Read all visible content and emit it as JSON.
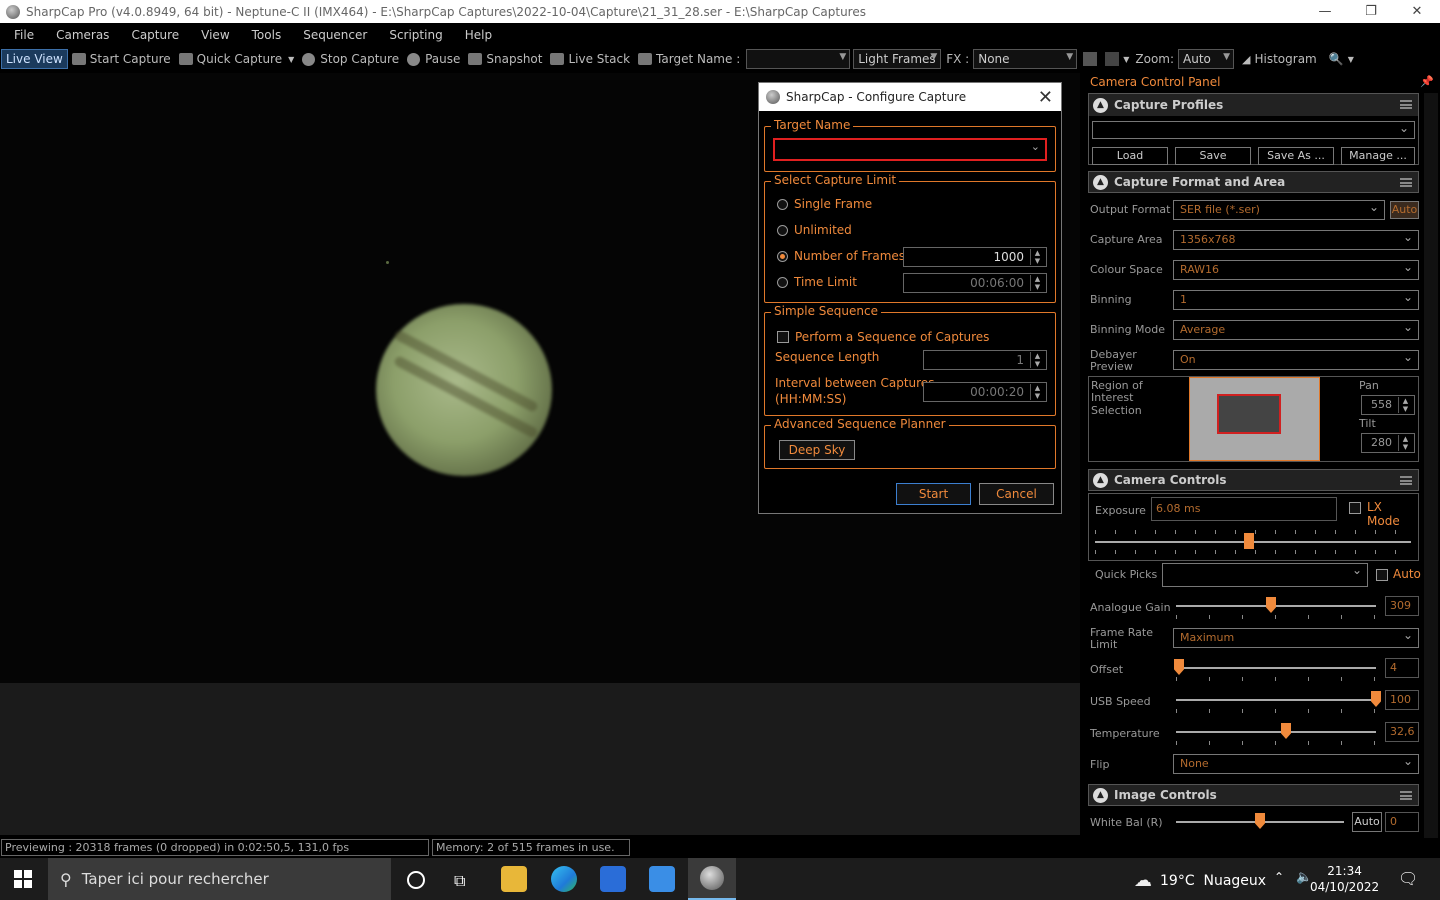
{
  "window": {
    "title": "SharpCap Pro (v4.0.8949, 64 bit) - Neptune-C II (IMX464) - E:\\SharpCap Captures\\2022-10-04\\Capture\\21_31_28.ser - E:\\SharpCap Captures",
    "minimize": "—",
    "maximize": "❐",
    "close": "✕"
  },
  "menu": [
    "File",
    "Cameras",
    "Capture",
    "View",
    "Tools",
    "Sequencer",
    "Scripting",
    "Help"
  ],
  "toolbar": {
    "live_view": "Live View",
    "start_capture": "Start Capture",
    "quick_capture": "Quick Capture",
    "stop_capture": "Stop Capture",
    "pause": "Pause",
    "snapshot": "Snapshot",
    "live_stack": "Live Stack",
    "target_name_label": "Target Name :",
    "target_name_value": "",
    "frame_type": "Light Frames",
    "fx_label": "FX :",
    "fx_value": "None",
    "zoom_label": "Zoom:",
    "zoom_value": "Auto",
    "histogram": "Histogram"
  },
  "dialog": {
    "title": "SharpCap - Configure Capture",
    "target_name_group": "Target Name",
    "target_name_value": "",
    "capture_limit_group": "Select Capture Limit",
    "single_frame": "Single Frame",
    "unlimited": "Unlimited",
    "number_of_frames": "Number of Frames",
    "number_of_frames_value": "1000",
    "time_limit": "Time Limit",
    "time_limit_value": "00:06:00",
    "simple_sequence_group": "Simple Sequence",
    "perform_sequence": "Perform a Sequence of Captures",
    "sequence_length": "Sequence Length",
    "sequence_length_value": "1",
    "interval_label": "Interval between Captures",
    "interval_format": "(HH:MM:SS)",
    "interval_value": "00:00:20",
    "advanced_group": "Advanced Sequence Planner",
    "deep_sky": "Deep Sky",
    "start": "Start",
    "cancel": "Cancel"
  },
  "panel": {
    "title": "Camera Control Panel",
    "capture_profiles": {
      "header": "Capture Profiles",
      "profile_value": "",
      "load": "Load",
      "save": "Save",
      "save_as": "Save As ...",
      "manage": "Manage ..."
    },
    "format_area": {
      "header": "Capture Format and Area",
      "output_format_label": "Output Format",
      "output_format_value": "SER file (*.ser)",
      "auto": "Auto",
      "capture_area_label": "Capture Area",
      "capture_area_value": "1356x768",
      "colour_space_label": "Colour Space",
      "colour_space_value": "RAW16",
      "binning_label": "Binning",
      "binning_value": "1",
      "binning_mode_label": "Binning Mode",
      "binning_mode_value": "Average",
      "debayer_label": "Debayer",
      "debayer_label2": "Preview",
      "debayer_value": "On",
      "roi_label1": "Region of",
      "roi_label2": "Interest",
      "roi_label3": "Selection",
      "pan_label": "Pan",
      "pan_value": "558",
      "tilt_label": "Tilt",
      "tilt_value": "280"
    },
    "camera_controls": {
      "header": "Camera Controls",
      "exposure_label": "Exposure",
      "exposure_value": "6.08 ms",
      "lx_mode": "LX Mode",
      "quick_picks_label": "Quick Picks",
      "quick_picks_value": "",
      "auto": "Auto",
      "analogue_gain_label": "Analogue Gain",
      "analogue_gain_value": "309",
      "frame_rate_label1": "Frame Rate",
      "frame_rate_label2": "Limit",
      "frame_rate_value": "Maximum",
      "offset_label": "Offset",
      "offset_value": "4",
      "usb_speed_label": "USB Speed",
      "usb_speed_value": "100",
      "temperature_label": "Temperature",
      "temperature_value": "32,6",
      "flip_label": "Flip",
      "flip_value": "None"
    },
    "image_controls": {
      "header": "Image Controls",
      "white_bal_label": "White Bal (R)",
      "auto": "Auto",
      "white_bal_value": "0"
    }
  },
  "status": {
    "previewing": "Previewing : 20318 frames (0 dropped) in 0:02:50,5, 131,0 fps",
    "memory": "Memory: 2 of 515 frames in use."
  },
  "taskbar": {
    "search_placeholder": "Taper ici pour rechercher",
    "weather": "19°C  Nuageux",
    "time": "21:34",
    "date": "04/10/2022"
  }
}
